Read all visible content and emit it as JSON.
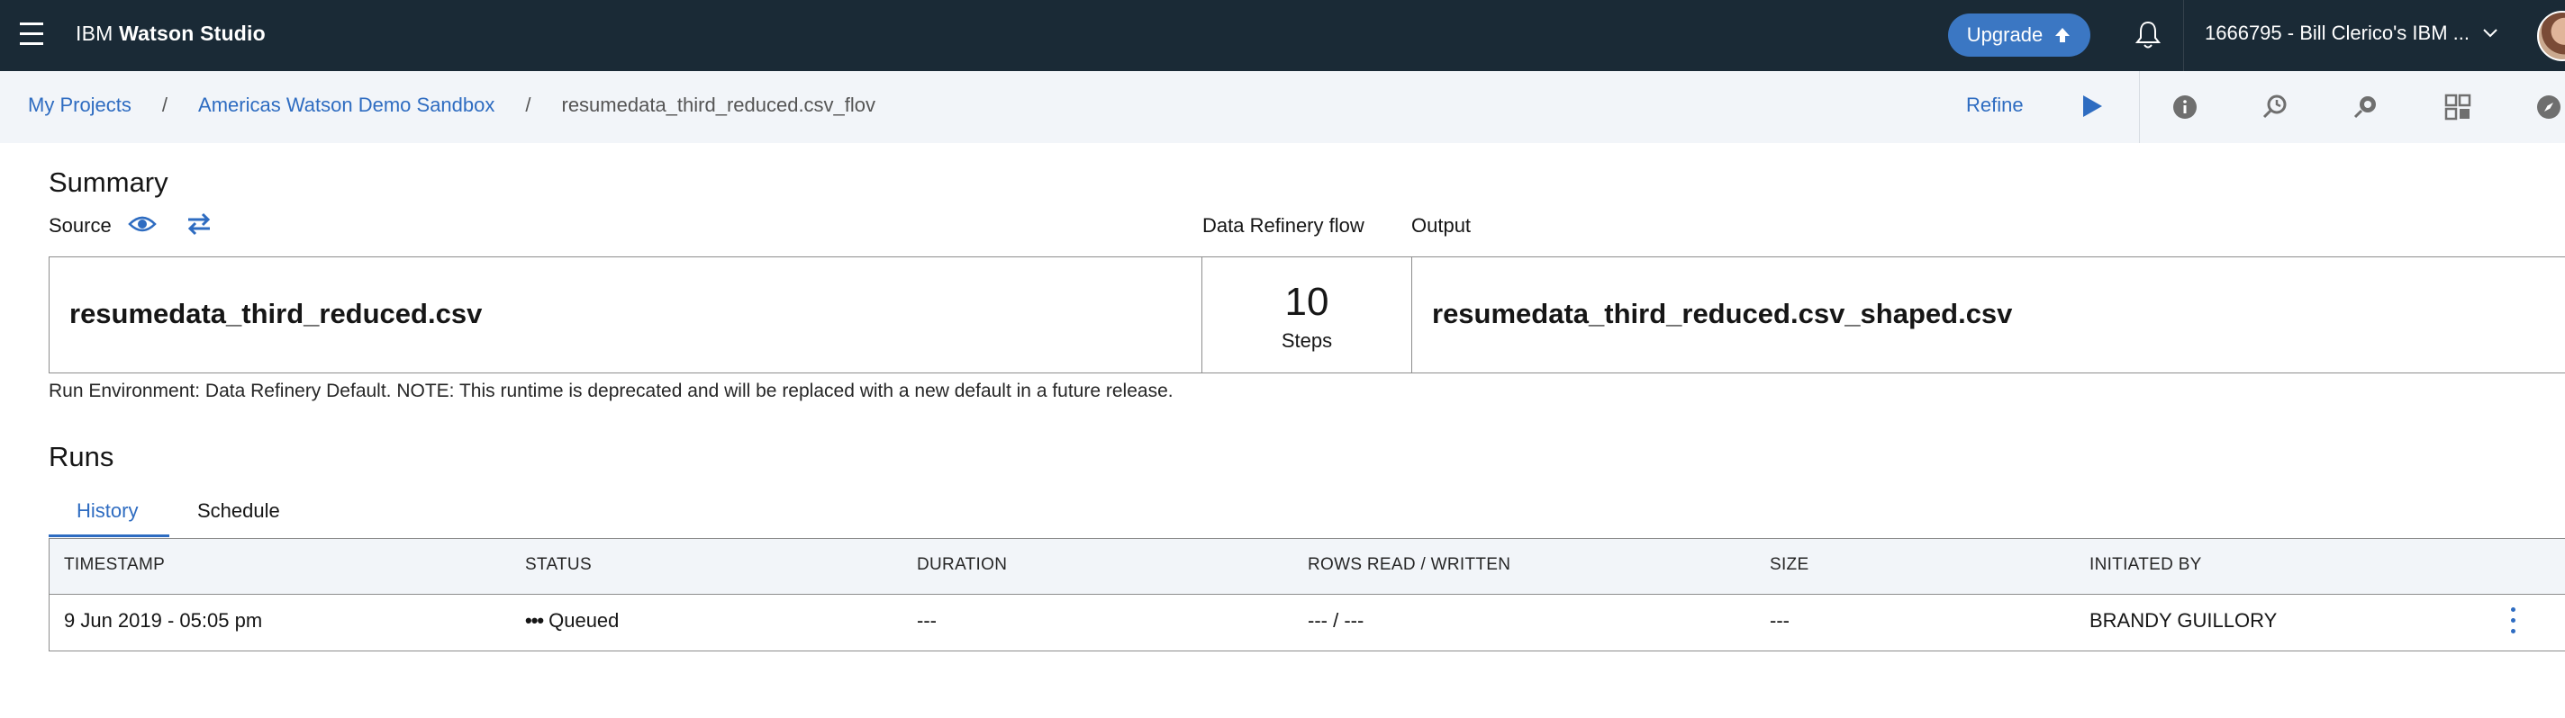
{
  "topbar": {
    "brand_prefix": "IBM",
    "brand_name": "Watson Studio",
    "upgrade_label": "Upgrade",
    "account_label": "1666795 - Bill Clerico's IBM ...",
    "bg_color": "#1a2a36",
    "accent_color": "#3b77c3"
  },
  "breadcrumb": {
    "items": [
      "My Projects",
      "Americas Watson Demo Sandbox",
      "resumedata_third_reduced.csv_flov"
    ],
    "separator": "/"
  },
  "toolbar": {
    "refine_label": "Refine",
    "icons": [
      "play-icon",
      "info-icon",
      "schedule-job-icon",
      "jobs-icon",
      "grid-view-icon",
      "compass-icon"
    ]
  },
  "summary": {
    "title": "Summary",
    "source_label": "Source",
    "flow_label": "Data Refinery flow",
    "output_label": "Output",
    "source_file": "resumedata_third_reduced.csv",
    "steps_count": "10",
    "steps_label": "Steps",
    "output_file": "resumedata_third_reduced.csv_shaped.csv",
    "run_environment": "Run Environment: Data Refinery Default. NOTE: This runtime is deprecated and will be replaced with a new default in a future release."
  },
  "runs": {
    "title": "Runs",
    "tabs": [
      "History",
      "Schedule"
    ],
    "active_tab": "History",
    "columns": [
      "TIMESTAMP",
      "STATUS",
      "DURATION",
      "ROWS READ / WRITTEN",
      "SIZE",
      "INITIATED BY"
    ],
    "rows": [
      {
        "timestamp": "9 Jun 2019 - 05:05 pm",
        "status_dots": "•••",
        "status": "Queued",
        "duration": "---",
        "rows_read_written": "--- / ---",
        "size": "---",
        "initiated_by": "BRANDY GUILLORY"
      }
    ]
  }
}
